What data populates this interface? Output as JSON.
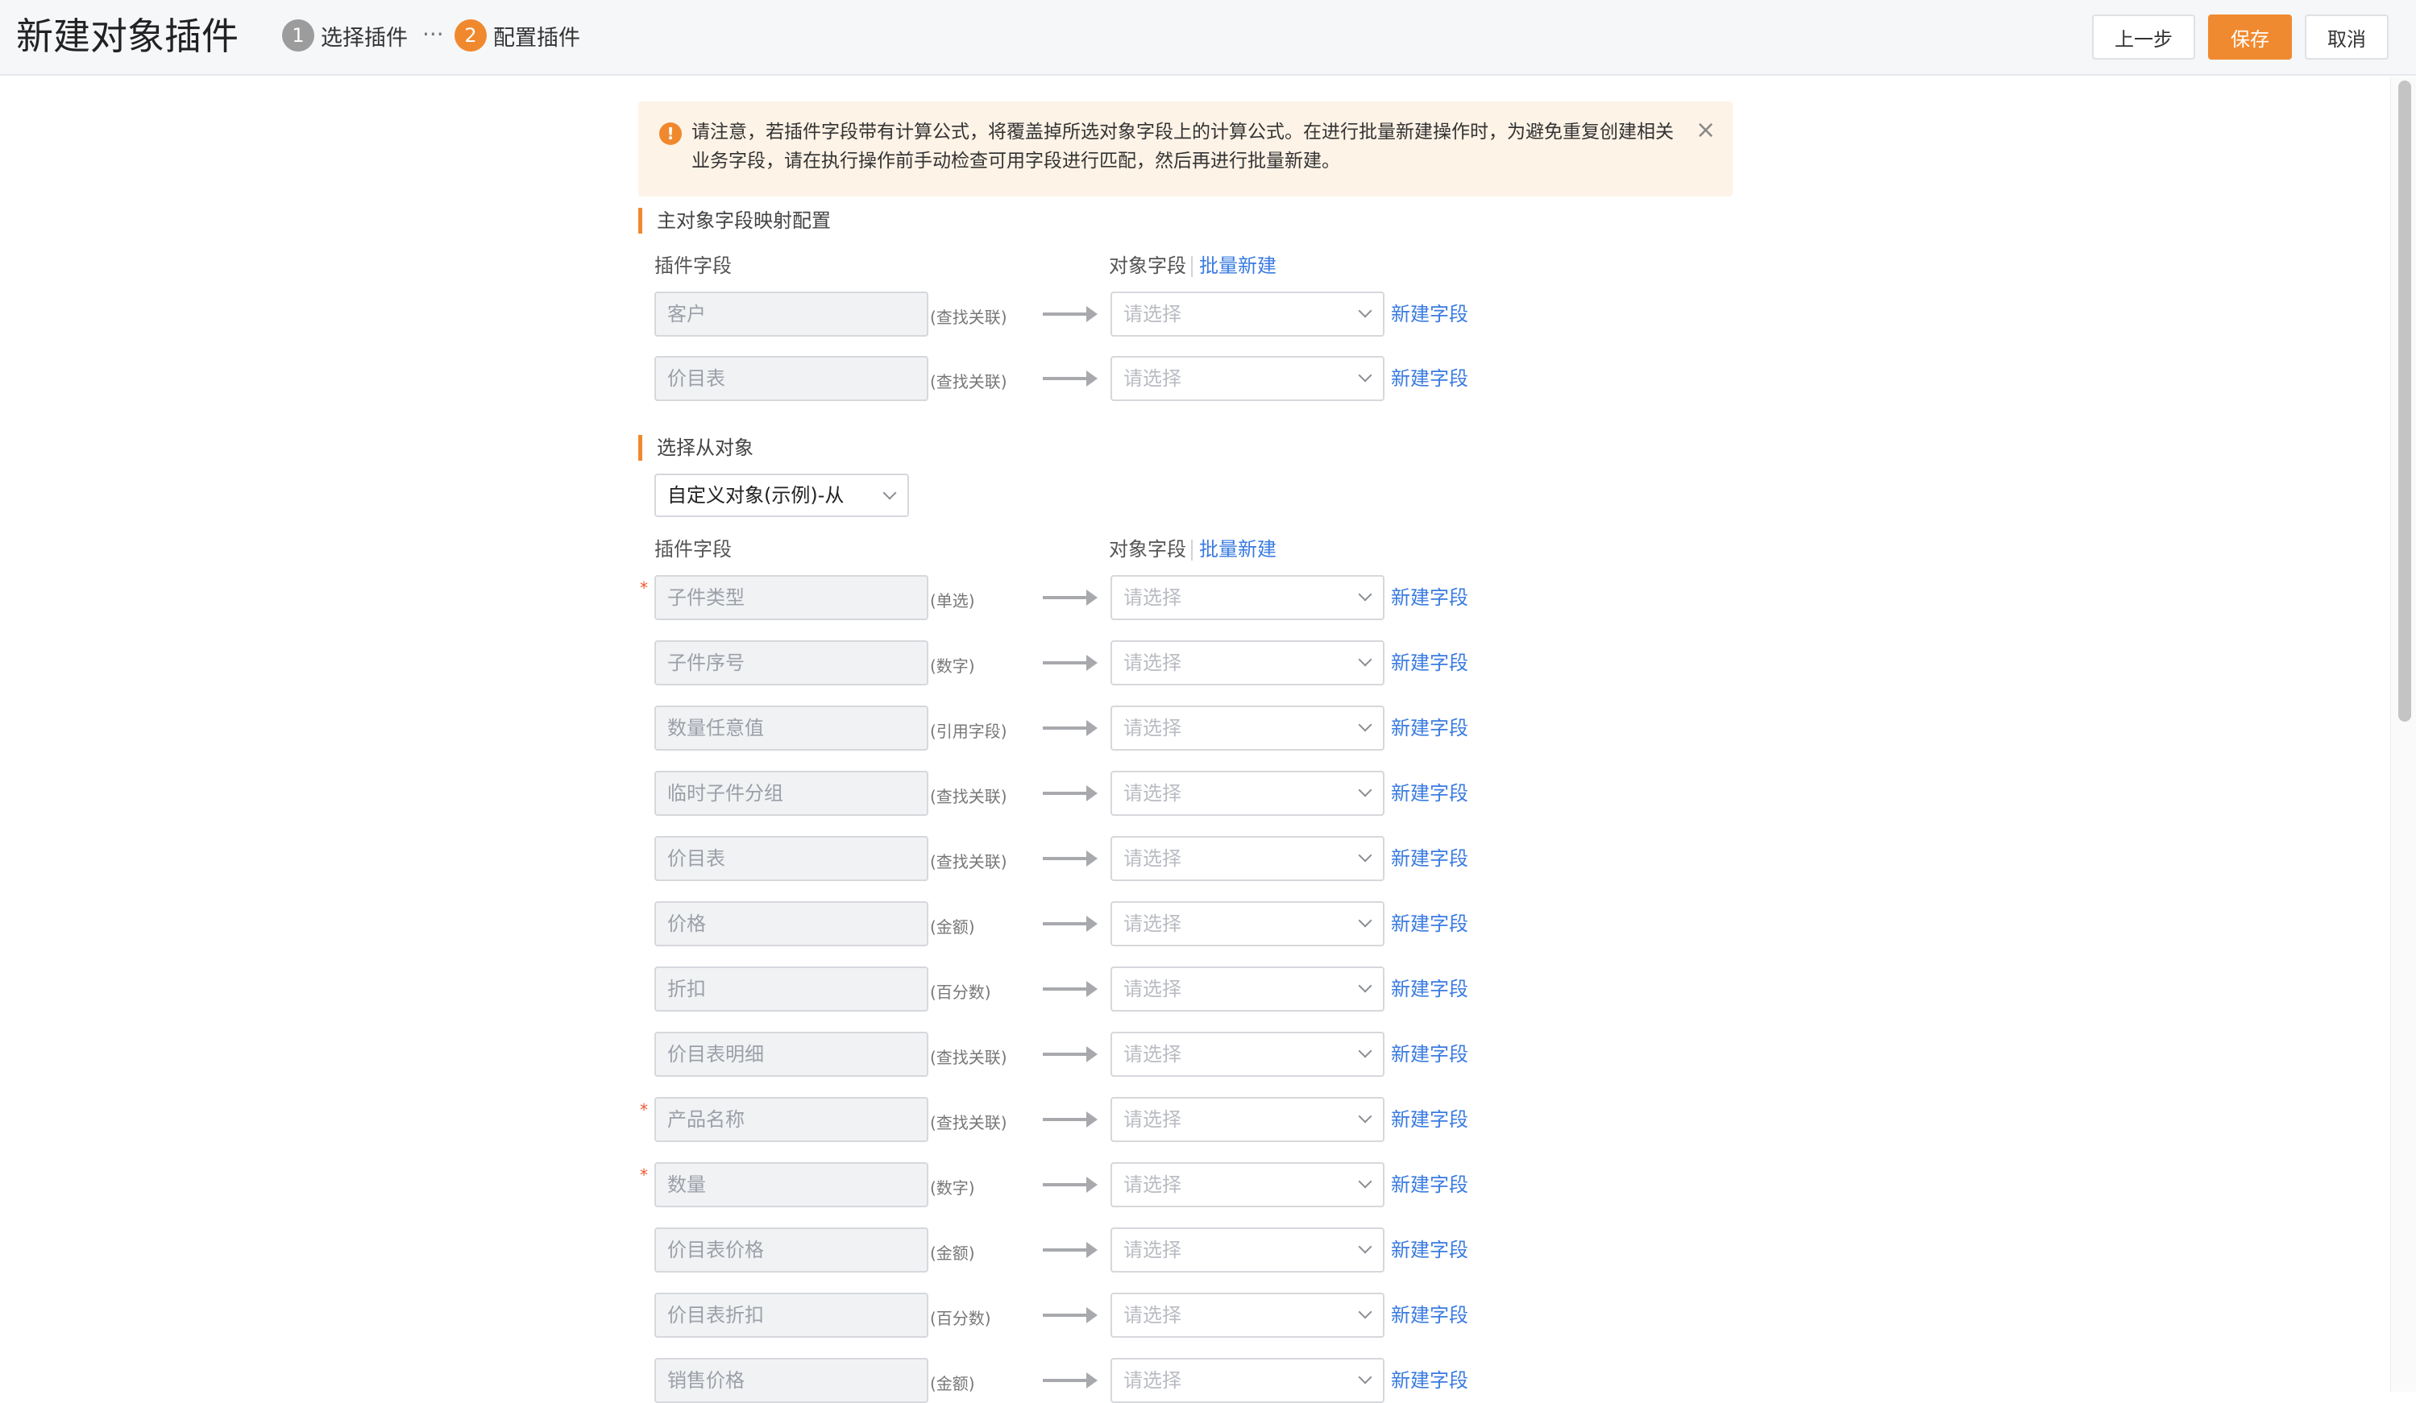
{
  "header": {
    "title": "新建对象插件",
    "steps": [
      {
        "num": "1",
        "label": "选择插件"
      },
      {
        "num": "2",
        "label": "配置插件"
      }
    ],
    "dots": "···",
    "buttons": {
      "prev": "上一步",
      "save": "保存",
      "cancel": "取消"
    },
    "colors": {
      "accent": "#f0892e",
      "link": "#3a7be0"
    }
  },
  "notice": {
    "icon": "!",
    "text": "请注意，若插件字段带有计算公式，将覆盖掉所选对象字段上的计算公式。在进行批量新建操作时，为避免重复创建相关业务字段，请在执行操作前手动检查可用字段进行匹配，然后再进行批量新建。",
    "close": "×"
  },
  "main_section": {
    "title": "主对象字段映射配置",
    "plugin_field_label": "插件字段",
    "object_field_label": "对象字段",
    "batch_new": "批量新建",
    "rows": [
      {
        "field": "客户",
        "type": "(查找关联)",
        "select": "请选择",
        "new": "新建字段",
        "required": false
      },
      {
        "field": "价目表",
        "type": "(查找关联)",
        "select": "请选择",
        "new": "新建字段",
        "required": false
      }
    ]
  },
  "detail_section": {
    "title": "选择从对象",
    "object_select": "自定义对象(示例)-从",
    "plugin_field_label": "插件字段",
    "object_field_label": "对象字段",
    "batch_new": "批量新建",
    "rows": [
      {
        "field": "子件类型",
        "type": "(单选)",
        "select": "请选择",
        "new": "新建字段",
        "required": true
      },
      {
        "field": "子件序号",
        "type": "(数字)",
        "select": "请选择",
        "new": "新建字段",
        "required": false
      },
      {
        "field": "数量任意值",
        "type": "(引用字段)",
        "select": "请选择",
        "new": "新建字段",
        "required": false
      },
      {
        "field": "临时子件分组",
        "type": "(查找关联)",
        "select": "请选择",
        "new": "新建字段",
        "required": false
      },
      {
        "field": "价目表",
        "type": "(查找关联)",
        "select": "请选择",
        "new": "新建字段",
        "required": false
      },
      {
        "field": "价格",
        "type": "(金额)",
        "select": "请选择",
        "new": "新建字段",
        "required": false
      },
      {
        "field": "折扣",
        "type": "(百分数)",
        "select": "请选择",
        "new": "新建字段",
        "required": false
      },
      {
        "field": "价目表明细",
        "type": "(查找关联)",
        "select": "请选择",
        "new": "新建字段",
        "required": false
      },
      {
        "field": "产品名称",
        "type": "(查找关联)",
        "select": "请选择",
        "new": "新建字段",
        "required": true
      },
      {
        "field": "数量",
        "type": "(数字)",
        "select": "请选择",
        "new": "新建字段",
        "required": true
      },
      {
        "field": "价目表价格",
        "type": "(金额)",
        "select": "请选择",
        "new": "新建字段",
        "required": false
      },
      {
        "field": "价目表折扣",
        "type": "(百分数)",
        "select": "请选择",
        "new": "新建字段",
        "required": false
      },
      {
        "field": "销售价格",
        "type": "(金额)",
        "select": "请选择",
        "new": "新建字段",
        "required": false
      }
    ]
  }
}
